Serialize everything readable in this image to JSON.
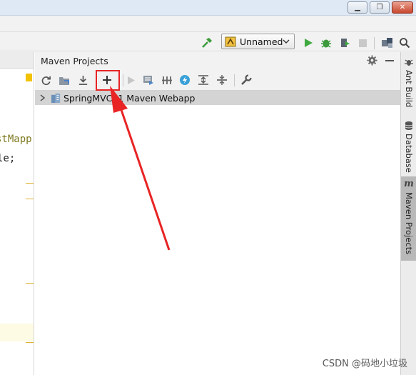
{
  "window": {
    "buttons": [
      "minimize",
      "restore",
      "close"
    ]
  },
  "toolbar": {
    "run_config_label": "Unnamed",
    "icons": [
      "hammer-icon",
      "run-icon",
      "debug-icon",
      "coverage-icon",
      "stop-icon",
      "project-structure-icon",
      "search-icon"
    ]
  },
  "editor": {
    "code_lines": [
      "stMapp",
      "le;"
    ]
  },
  "panel": {
    "title": "Maven Projects",
    "toolbar_icons": [
      "reimport-icon",
      "generate-sources-icon",
      "download-icon",
      "add-icon",
      "run-goal-icon",
      "run-configuration-icon",
      "skip-tests-icon",
      "offline-icon",
      "expand-all-icon",
      "collapse-all-icon",
      "settings-icon"
    ],
    "tree": [
      {
        "label": "SpringMVC01 Maven Webapp",
        "expanded": false
      }
    ]
  },
  "stripe": {
    "items": [
      {
        "label": "Ant Build",
        "active": false
      },
      {
        "label": "Database",
        "active": false
      },
      {
        "label": "Maven Projects",
        "active": true
      }
    ]
  },
  "annotation": {
    "color": "#e82424"
  },
  "watermark": "CSDN @码地小垃圾"
}
